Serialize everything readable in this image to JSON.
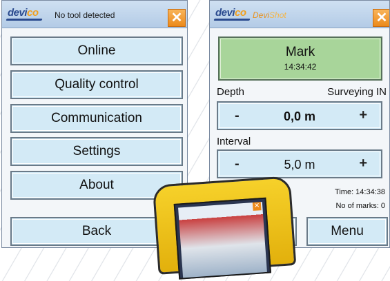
{
  "left_screen": {
    "logo": {
      "part1": "devi",
      "part2": "co"
    },
    "title": "No tool detected",
    "close": "✕",
    "menu": [
      {
        "label": "Online"
      },
      {
        "label": "Quality control"
      },
      {
        "label": "Communication"
      },
      {
        "label": "Settings"
      },
      {
        "label": "About"
      },
      {
        "label": "Back"
      }
    ]
  },
  "right_screen": {
    "logo": {
      "part1": "devi",
      "part2": "co"
    },
    "app_name": {
      "part1": "Devi",
      "part2": "Shot"
    },
    "close": "✕",
    "mark_button": {
      "label": "Mark",
      "time": "14:34:42"
    },
    "depth": {
      "label": "Depth",
      "mode": "Surveying IN",
      "minus": "-",
      "value": "0,0 m",
      "plus": "+"
    },
    "interval": {
      "label": "Interval",
      "minus": "-",
      "value": "5,0 m",
      "plus": "+"
    },
    "info": {
      "time": "Time: 14:34:38",
      "marks": "No of marks: 0"
    },
    "menu_label": "Menu"
  },
  "device": {
    "close": "✕"
  },
  "colors": {
    "accent": "#ec8a1a",
    "button_bg": "#d3eaf6",
    "mark_bg": "#a8d59a",
    "device_body": "#f0c81e"
  }
}
